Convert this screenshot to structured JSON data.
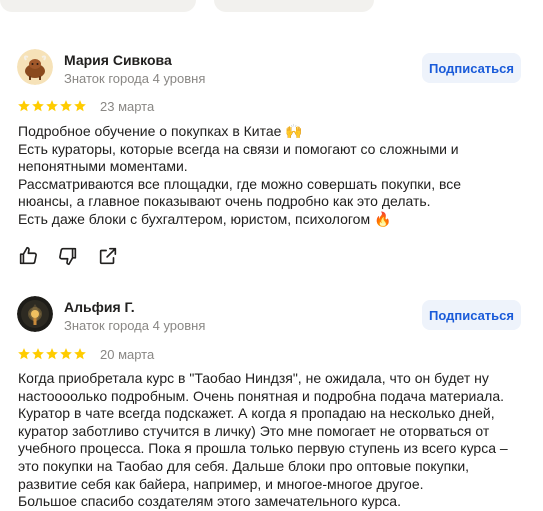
{
  "top_cards": [
    "",
    ""
  ],
  "reviews": [
    {
      "name": "Мария Сивкова",
      "level": "Знаток города 4 уровня",
      "subscribe_label": "Подписаться",
      "rating": 5,
      "date": "23 марта",
      "lines": [
        "Подробное обучение о покупках в Китае 🙌",
        "Есть кураторы, которые всегда на связи и помогают со сложными и",
        "непонятными моментами.",
        "Рассматриваются все площадки, где можно совершать покупки, все",
        "нюансы, а главное показывают очень подробно как это делать.",
        "Есть даже блоки с бухгалтером, юристом, психологом 🔥"
      ],
      "avatar_icon": "yak-avatar",
      "actions": [
        "like-icon",
        "dislike-icon",
        "share-icon"
      ]
    },
    {
      "name": "Альфия Г.",
      "level": "Знаток города 4 уровня",
      "subscribe_label": "Подписаться",
      "rating": 5,
      "date": "20 марта",
      "lines": [
        "Когда приобретала курс в \"Таобао Ниндзя\", не ожидала, что он будет ну",
        "настоооолько подробным. Очень понятная и подробна подача материала.",
        "Куратор в чате всегда подскажет. А когда я пропадаю на несколько дней,",
        "куратор заботливо стучится в личку) Это мне помогает не оторваться от",
        "учебного процесса. Пока я прошла только первую ступень из всего курса –",
        "это покупки на Таобао для себя. Дальше блоки про оптовые покупки,",
        "развитие себя как байера, например, и многое-многое другое.",
        "Большое спасибо создателям этого замечательного курса."
      ],
      "avatar_icon": "lamp-avatar"
    }
  ],
  "colors": {
    "star": "#fc0",
    "subscribe_bg": "#eef3fb",
    "subscribe_text": "#1a5bd9",
    "muted": "#898784"
  }
}
